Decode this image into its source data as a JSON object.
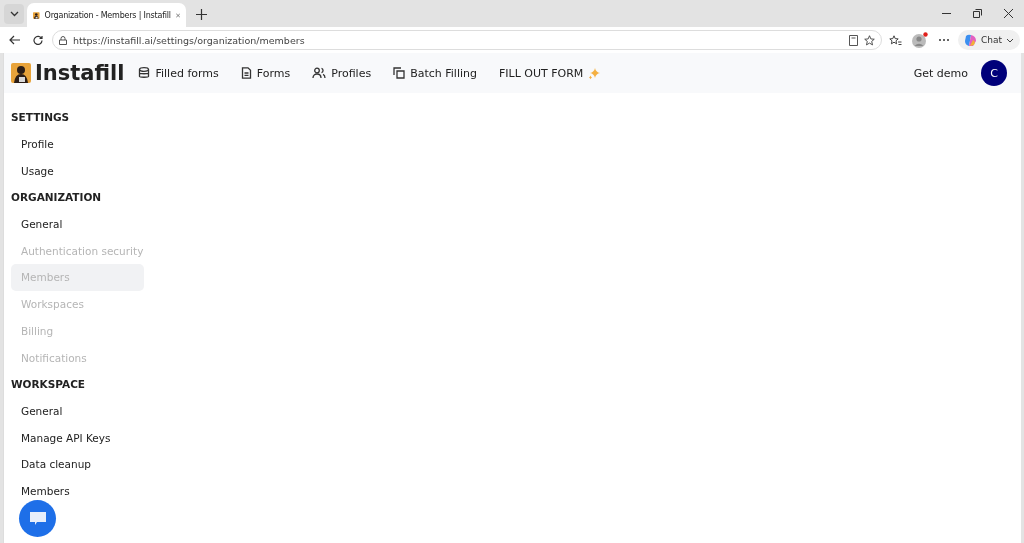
{
  "browser": {
    "tab_title": "Organization - Members | Instafill",
    "url": "https://instafill.ai/settings/organization/members",
    "chat_label": "Chat"
  },
  "nav": {
    "brand": "Instafill",
    "items": [
      {
        "label": "Filled forms",
        "kind": "database"
      },
      {
        "label": "Forms",
        "kind": "document"
      },
      {
        "label": "Profiles",
        "kind": "people"
      },
      {
        "label": "Batch Filling",
        "kind": "copy"
      },
      {
        "label": "FILL OUT FORM",
        "kind": "sparkle"
      }
    ],
    "get_demo": "Get demo",
    "avatar": "C"
  },
  "sidebar": {
    "sections": [
      {
        "heading": "SETTINGS",
        "items": [
          {
            "label": "Profile",
            "disabled": false,
            "selected": false
          },
          {
            "label": "Usage",
            "disabled": false,
            "selected": false
          }
        ]
      },
      {
        "heading": "ORGANIZATION",
        "items": [
          {
            "label": "General",
            "disabled": false,
            "selected": false
          },
          {
            "label": "Authentication security",
            "disabled": true,
            "selected": false
          },
          {
            "label": "Members",
            "disabled": true,
            "selected": true
          },
          {
            "label": "Workspaces",
            "disabled": true,
            "selected": false
          },
          {
            "label": "Billing",
            "disabled": true,
            "selected": false
          },
          {
            "label": "Notifications",
            "disabled": true,
            "selected": false
          }
        ]
      },
      {
        "heading": "WORKSPACE",
        "items": [
          {
            "label": "General",
            "disabled": false,
            "selected": false
          },
          {
            "label": "Manage API Keys",
            "disabled": false,
            "selected": false
          },
          {
            "label": "Data cleanup",
            "disabled": false,
            "selected": false
          },
          {
            "label": "Members",
            "disabled": false,
            "selected": false
          }
        ]
      }
    ]
  }
}
